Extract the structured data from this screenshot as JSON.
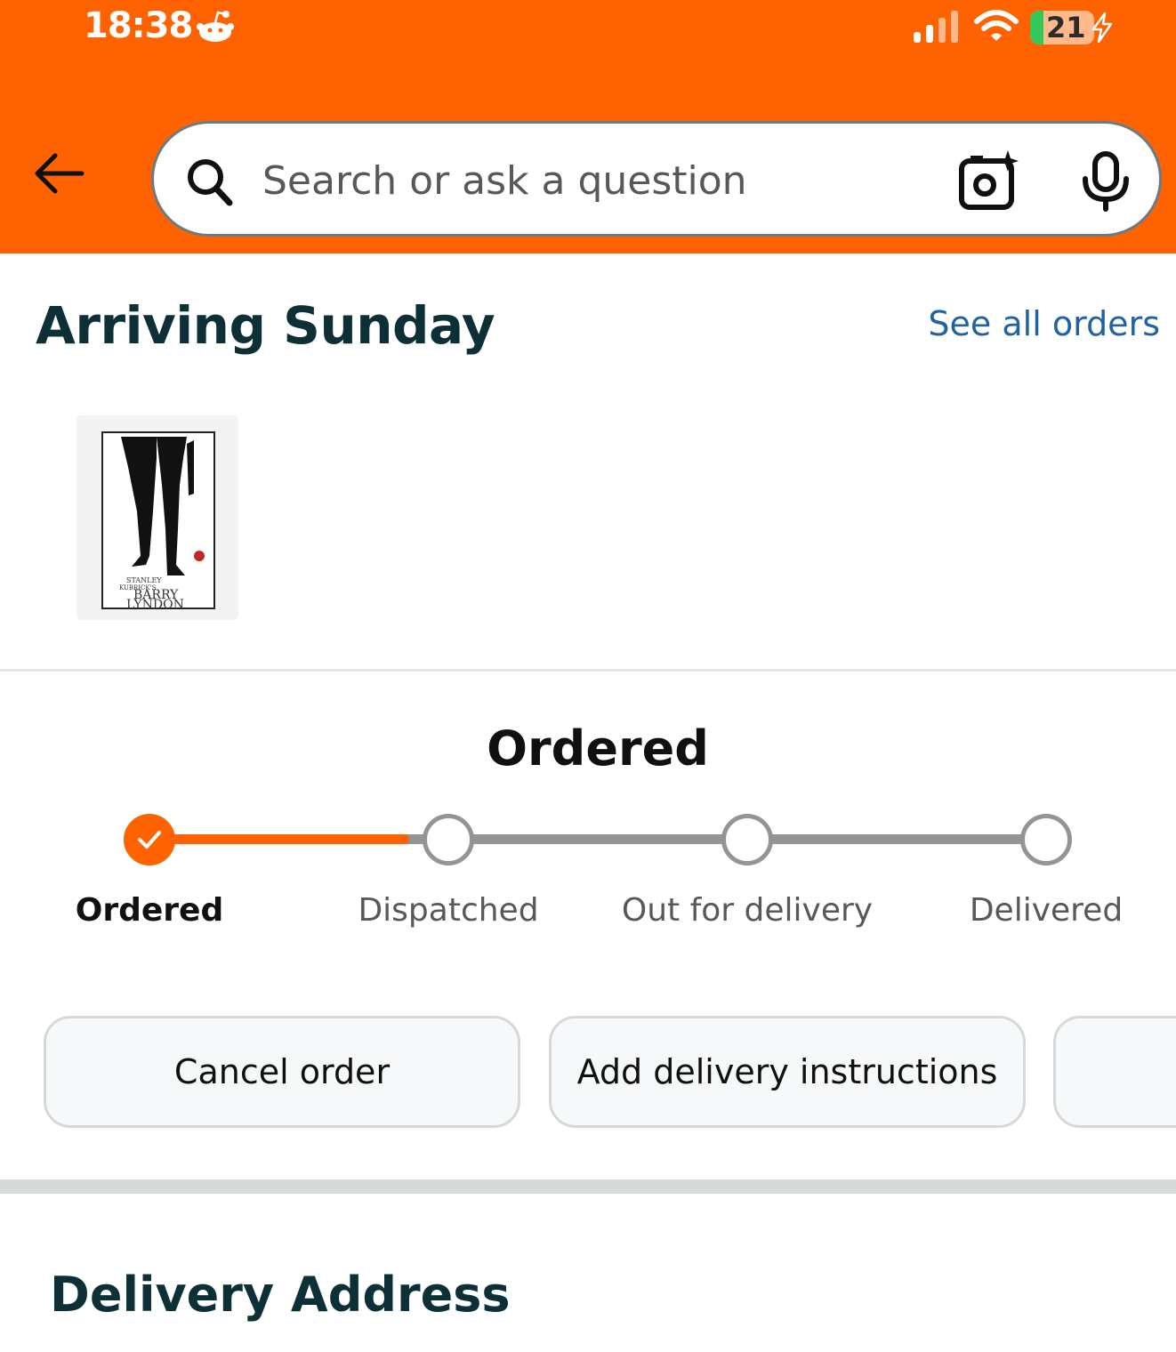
{
  "status_bar": {
    "time": "18:38",
    "battery_level": "21",
    "battery_fraction": 0.21
  },
  "search": {
    "placeholder": "Search or ask a question"
  },
  "arriving": {
    "title": "Arriving Sunday",
    "see_all": "See all orders"
  },
  "product": {
    "image_label": "Barry Lyndon DVD cover"
  },
  "tracker": {
    "title": "Ordered",
    "progress_fraction": 0.29,
    "steps": [
      {
        "label": "Ordered",
        "done": true
      },
      {
        "label": "Dispatched",
        "done": false
      },
      {
        "label": "Out for delivery",
        "done": false
      },
      {
        "label": "Delivered",
        "done": false
      }
    ]
  },
  "actions": [
    {
      "label": "Cancel order"
    },
    {
      "label": "Add delivery instructions"
    },
    {
      "label": ""
    }
  ],
  "delivery": {
    "title": "Delivery Address"
  },
  "colors": {
    "header": "#ff6200",
    "heading": "#0d2f36",
    "link": "#2162a1",
    "progress": "#ff6200"
  }
}
